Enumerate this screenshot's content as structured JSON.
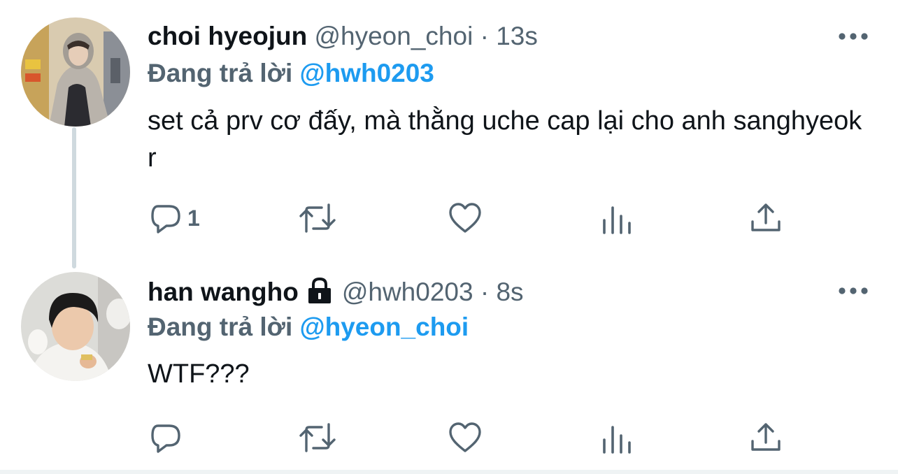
{
  "tweets": [
    {
      "author_name": "choi hyeojun",
      "handle": "@hyeon_choi",
      "separator": "·",
      "time": "13s",
      "reply_prefix": "Đang trả lời",
      "reply_to": "@hwh0203",
      "text": "set cả prv cơ đấy, mà thằng uche cap lại cho anh sanghyeok r",
      "protected": false,
      "reply_count": "1"
    },
    {
      "author_name": "han wangho",
      "handle": "@hwh0203",
      "separator": "·",
      "time": "8s",
      "reply_prefix": "Đang trả lời",
      "reply_to": "@hyeon_choi",
      "text": "WTF???",
      "protected": true,
      "reply_count": ""
    }
  ],
  "icons": {
    "more": "more-horizontal-icon",
    "reply": "reply-bubble-icon",
    "retweet": "retweet-icon",
    "like": "heart-icon",
    "views": "bar-chart-icon",
    "share": "share-upload-icon",
    "protected": "lock-icon"
  },
  "colors": {
    "text_primary": "#0f1419",
    "text_secondary": "#536471",
    "mention_blue": "#1d9bf0",
    "thread_line": "#cfd9de"
  }
}
